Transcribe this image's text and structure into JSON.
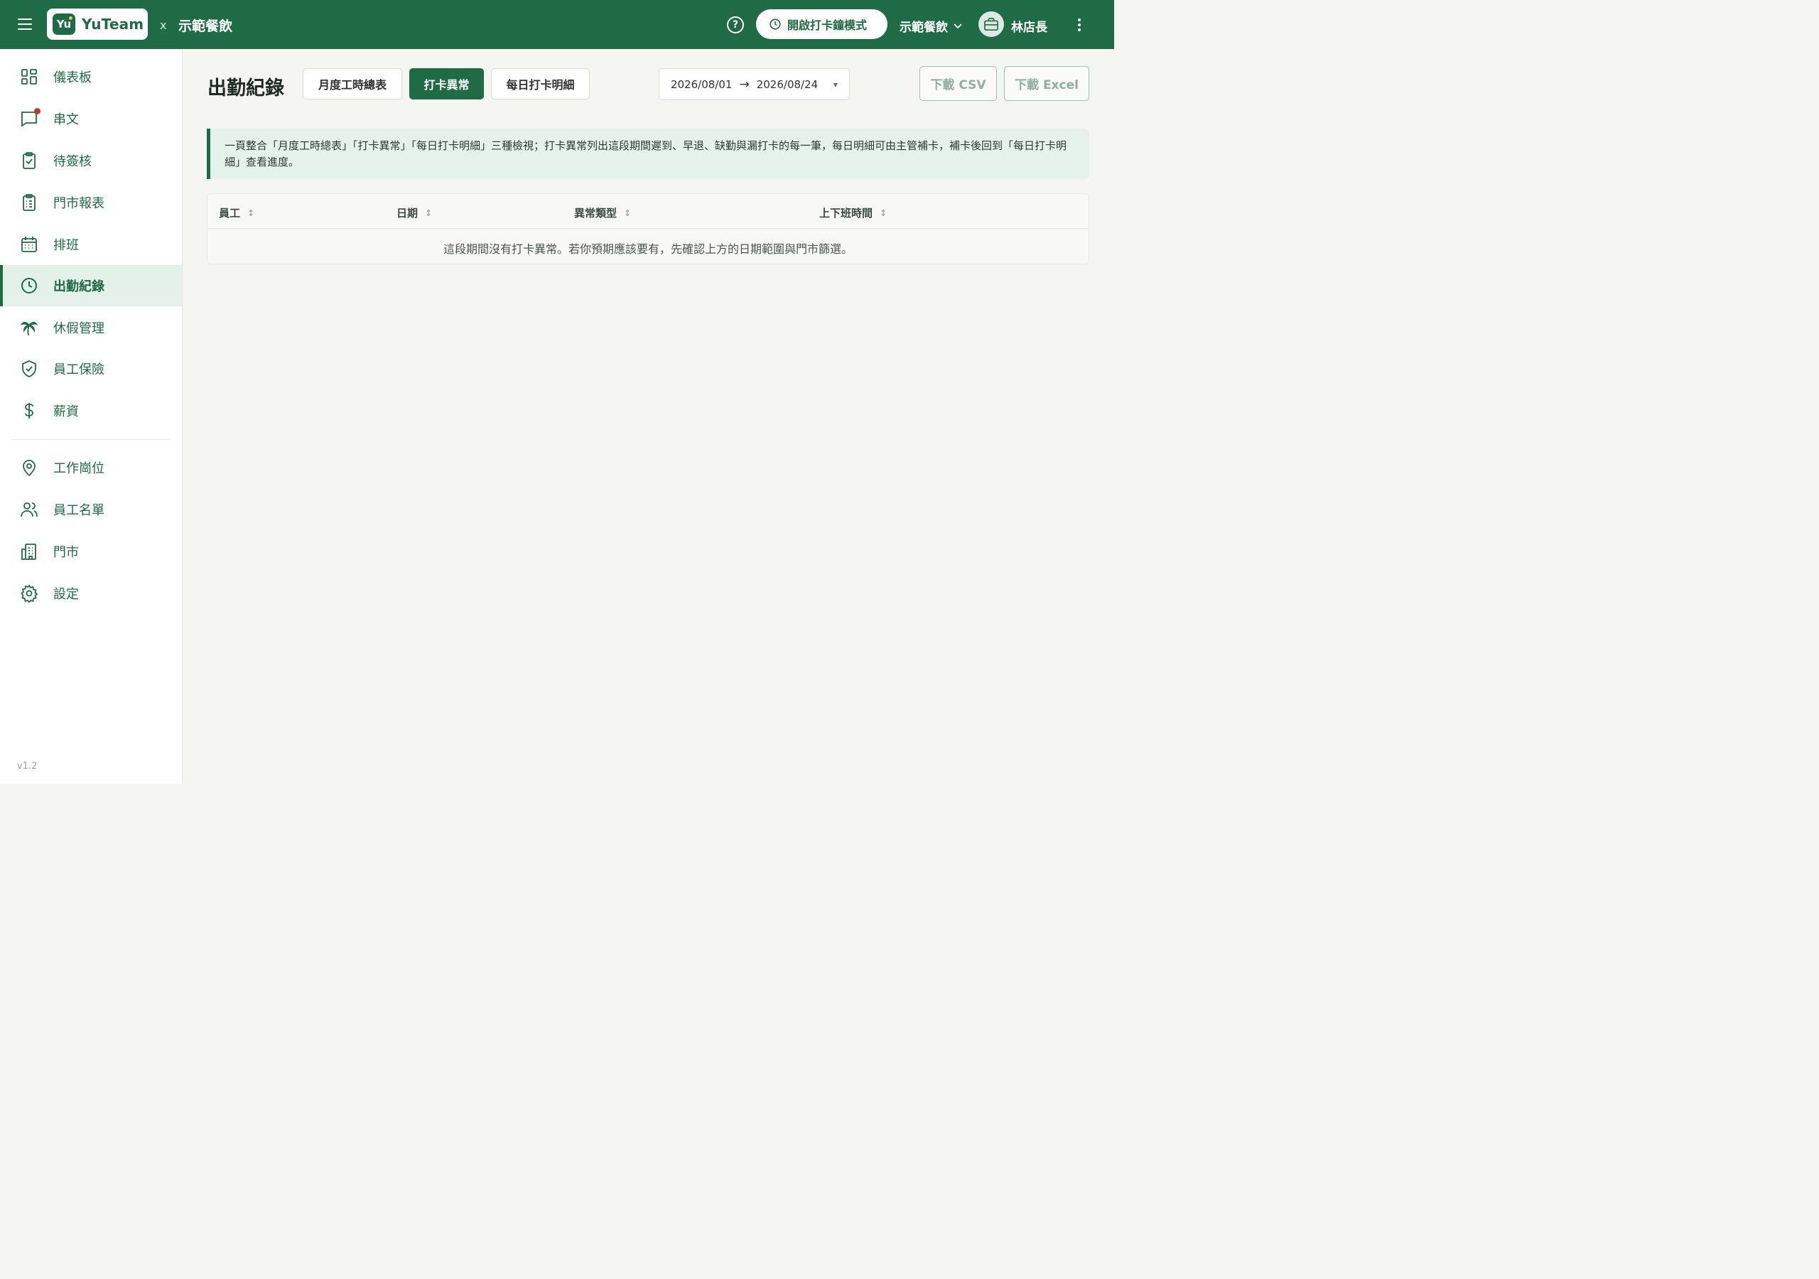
{
  "header": {
    "logo_badge": "Yu",
    "logo_text": "YuTeam",
    "separator": "x",
    "company": "示範餐飲",
    "clock_mode_label": "開啟打卡鐘模式",
    "store_select": "示範餐飲",
    "user_name": "林店長",
    "help_glyph": "?"
  },
  "sidebar": {
    "items": [
      {
        "label": "儀表板",
        "icon": "dashboard-icon"
      },
      {
        "label": "串文",
        "icon": "chat-icon"
      },
      {
        "label": "待簽核",
        "icon": "clipboard-check-icon"
      },
      {
        "label": "門市報表",
        "icon": "report-icon"
      },
      {
        "label": "排班",
        "icon": "calendar-icon"
      },
      {
        "label": "出勤紀錄",
        "icon": "clock-icon",
        "active": true
      },
      {
        "label": "休假管理",
        "icon": "palm-tree-icon"
      },
      {
        "label": "員工保險",
        "icon": "shield-check-icon"
      },
      {
        "label": "薪資",
        "icon": "dollar-icon"
      },
      {
        "label": "工作崗位",
        "icon": "location-pin-icon"
      },
      {
        "label": "員工名單",
        "icon": "users-icon"
      },
      {
        "label": "門市",
        "icon": "building-icon"
      },
      {
        "label": "設定",
        "icon": "gear-icon"
      }
    ],
    "version": "v1.2"
  },
  "main": {
    "title": "出勤紀錄",
    "tabs": [
      {
        "label": "月度工時總表"
      },
      {
        "label": "打卡異常",
        "active": true
      },
      {
        "label": "每日打卡明細"
      }
    ],
    "date_range": {
      "start": "2026/08/01",
      "arrow": "→",
      "end": "2026/08/24"
    },
    "download_csv": "下載 CSV",
    "download_excel": "下載 Excel",
    "notice": "一頁整合「月度工時總表」「打卡異常」「每日打卡明細」三種檢視；打卡異常列出這段期間遲到、早退、缺勤與漏打卡的每一筆，每日明細可由主管補卡，補卡後回到「每日打卡明細」查看進度。",
    "table": {
      "columns": [
        "員工",
        "日期",
        "異常類型",
        "上下班時間"
      ],
      "sort_glyph": "↕",
      "empty_message": "這段期間沒有打卡異常。若你預期應該要有，先確認上方的日期範圍與門市篩選。"
    }
  },
  "colors": {
    "brand": "#1f6b45",
    "active_bg": "#e4f1e8",
    "notice_bg": "#e5f2e9",
    "alert_dot": "#c0392b"
  }
}
